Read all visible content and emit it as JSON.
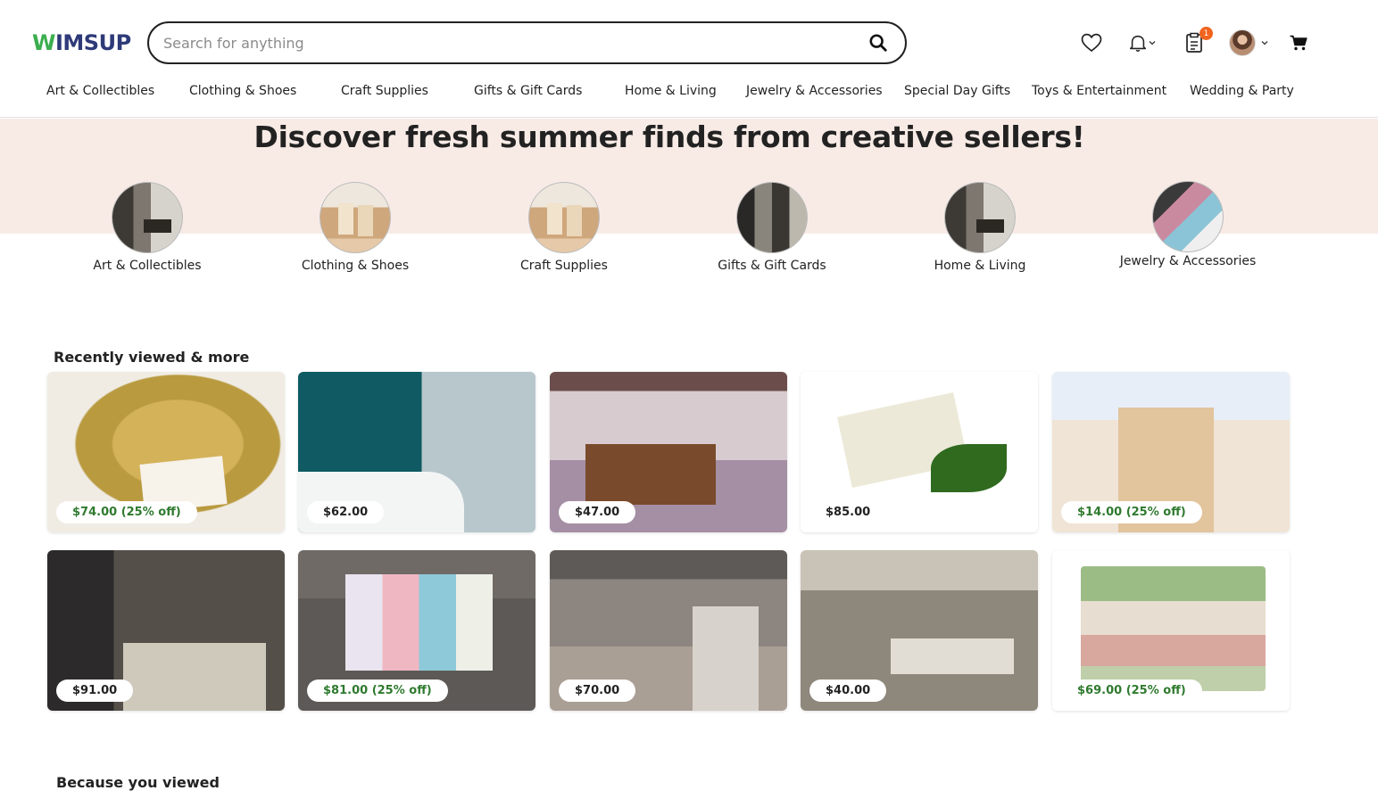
{
  "brand": {
    "logo_text": "IMSUP",
    "logo_first_letter": "W"
  },
  "search": {
    "placeholder": "Search for anything"
  },
  "header_icons": {
    "favorites": "heart-icon",
    "notifications": "bell-icon",
    "orders": "clipboard-icon",
    "orders_badge": "1",
    "account": "avatar",
    "cart": "cart-icon"
  },
  "nav": {
    "items": [
      "Art & Collectibles",
      "Clothing & Shoes",
      "Craft Supplies",
      "Gifts & Gift Cards",
      "Home & Living",
      "Jewelry & Accessories",
      "Special Day Gifts",
      "Toys & Entertainment",
      "Wedding & Party"
    ]
  },
  "hero": {
    "title": "Discover fresh summer finds from creative sellers!",
    "categories": [
      {
        "label": "Art & Collectibles"
      },
      {
        "label": "Clothing & Shoes"
      },
      {
        "label": "Craft Supplies"
      },
      {
        "label": "Gifts & Gift Cards"
      },
      {
        "label": "Home & Living"
      },
      {
        "label": "Jewelry & Accessories"
      }
    ]
  },
  "recent": {
    "title": "Recently viewed & more",
    "items": [
      {
        "price": "$74.00 (25% off)",
        "sale": true
      },
      {
        "price": "$62.00",
        "sale": false
      },
      {
        "price": "$47.00",
        "sale": false
      },
      {
        "price": "$85.00",
        "sale": false
      },
      {
        "price": "$14.00 (25% off)",
        "sale": true
      },
      {
        "price": "$91.00",
        "sale": false
      },
      {
        "price": "$81.00 (25% off)",
        "sale": true
      },
      {
        "price": "$70.00",
        "sale": false
      },
      {
        "price": "$40.00",
        "sale": false
      },
      {
        "price": "$69.00 (25% off)",
        "sale": true
      }
    ]
  },
  "because": {
    "title": "Because you viewed"
  },
  "colors": {
    "sale_price": "#2f7a2f",
    "badge": "#f1641e",
    "hero_band": "#f8ebe6",
    "logo_green": "#3cae4f",
    "logo_navy": "#2e3a78"
  }
}
